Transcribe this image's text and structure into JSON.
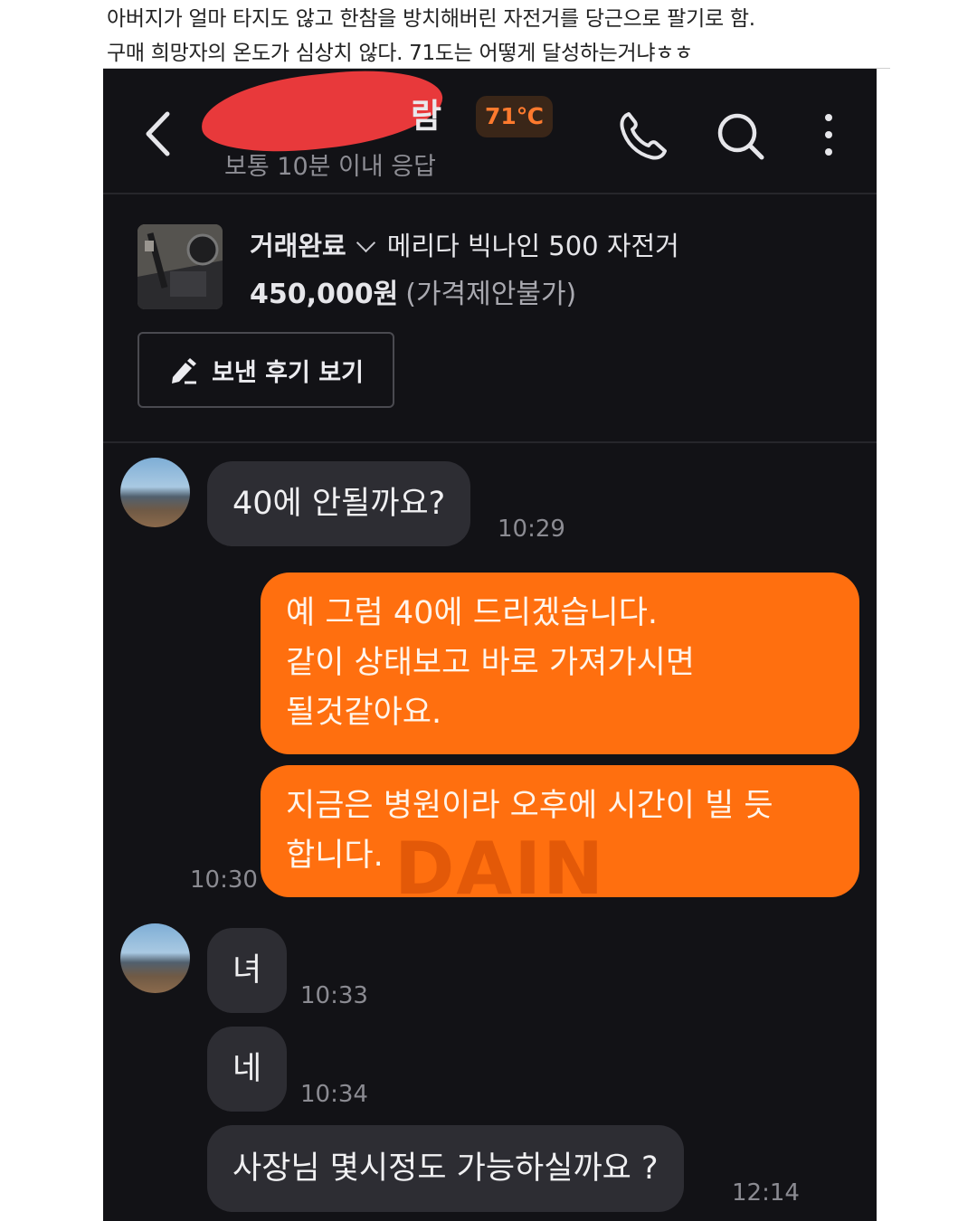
{
  "caption": {
    "line1": "아버지가 얼마 타지도 않고 한참을 방치해버린 자전거를 당근으로 팔기로 함.",
    "line2": "구매 희망자의 온도가 심상치 않다. 71도는 어떻게 달성하는거냐ㅎㅎ"
  },
  "header": {
    "name_visible": "람",
    "temperature": "71℃",
    "response_note": "보통 10분 이내 응답",
    "icons": [
      "back-icon",
      "phone-icon",
      "search-icon",
      "more-icon"
    ]
  },
  "product": {
    "status": "거래완료",
    "title": "메리다 빅나인 500 자전거",
    "price": "450,000원",
    "price_note": "(가격제안불가)",
    "review_button": "보낸 후기 보기"
  },
  "messages": [
    {
      "side": "in",
      "text": "40에 안될까요?",
      "time": "10:29"
    },
    {
      "side": "out",
      "lines": [
        "예 그럼 40에 드리겠습니다.",
        "같이 상태보고 바로 가져가시면",
        "될것같아요."
      ]
    },
    {
      "side": "out",
      "lines": [
        "지금은 병원이라 오후에 시간이 빌 듯",
        "합니다."
      ],
      "time": "10:30"
    },
    {
      "side": "in",
      "text": "녀",
      "time": "10:33"
    },
    {
      "side": "in",
      "text": "네",
      "time": "10:34"
    },
    {
      "side": "in",
      "text": "사장님 몇시정도 가능하실까요 ?",
      "time": "12:14"
    }
  ],
  "watermark": "DAIN",
  "colors": {
    "background": "#121216",
    "incoming_bubble": "#2d2d33",
    "outgoing_bubble": "#ff6f0f",
    "temperature": "#ff7a2e",
    "redaction": "#e8393b"
  }
}
